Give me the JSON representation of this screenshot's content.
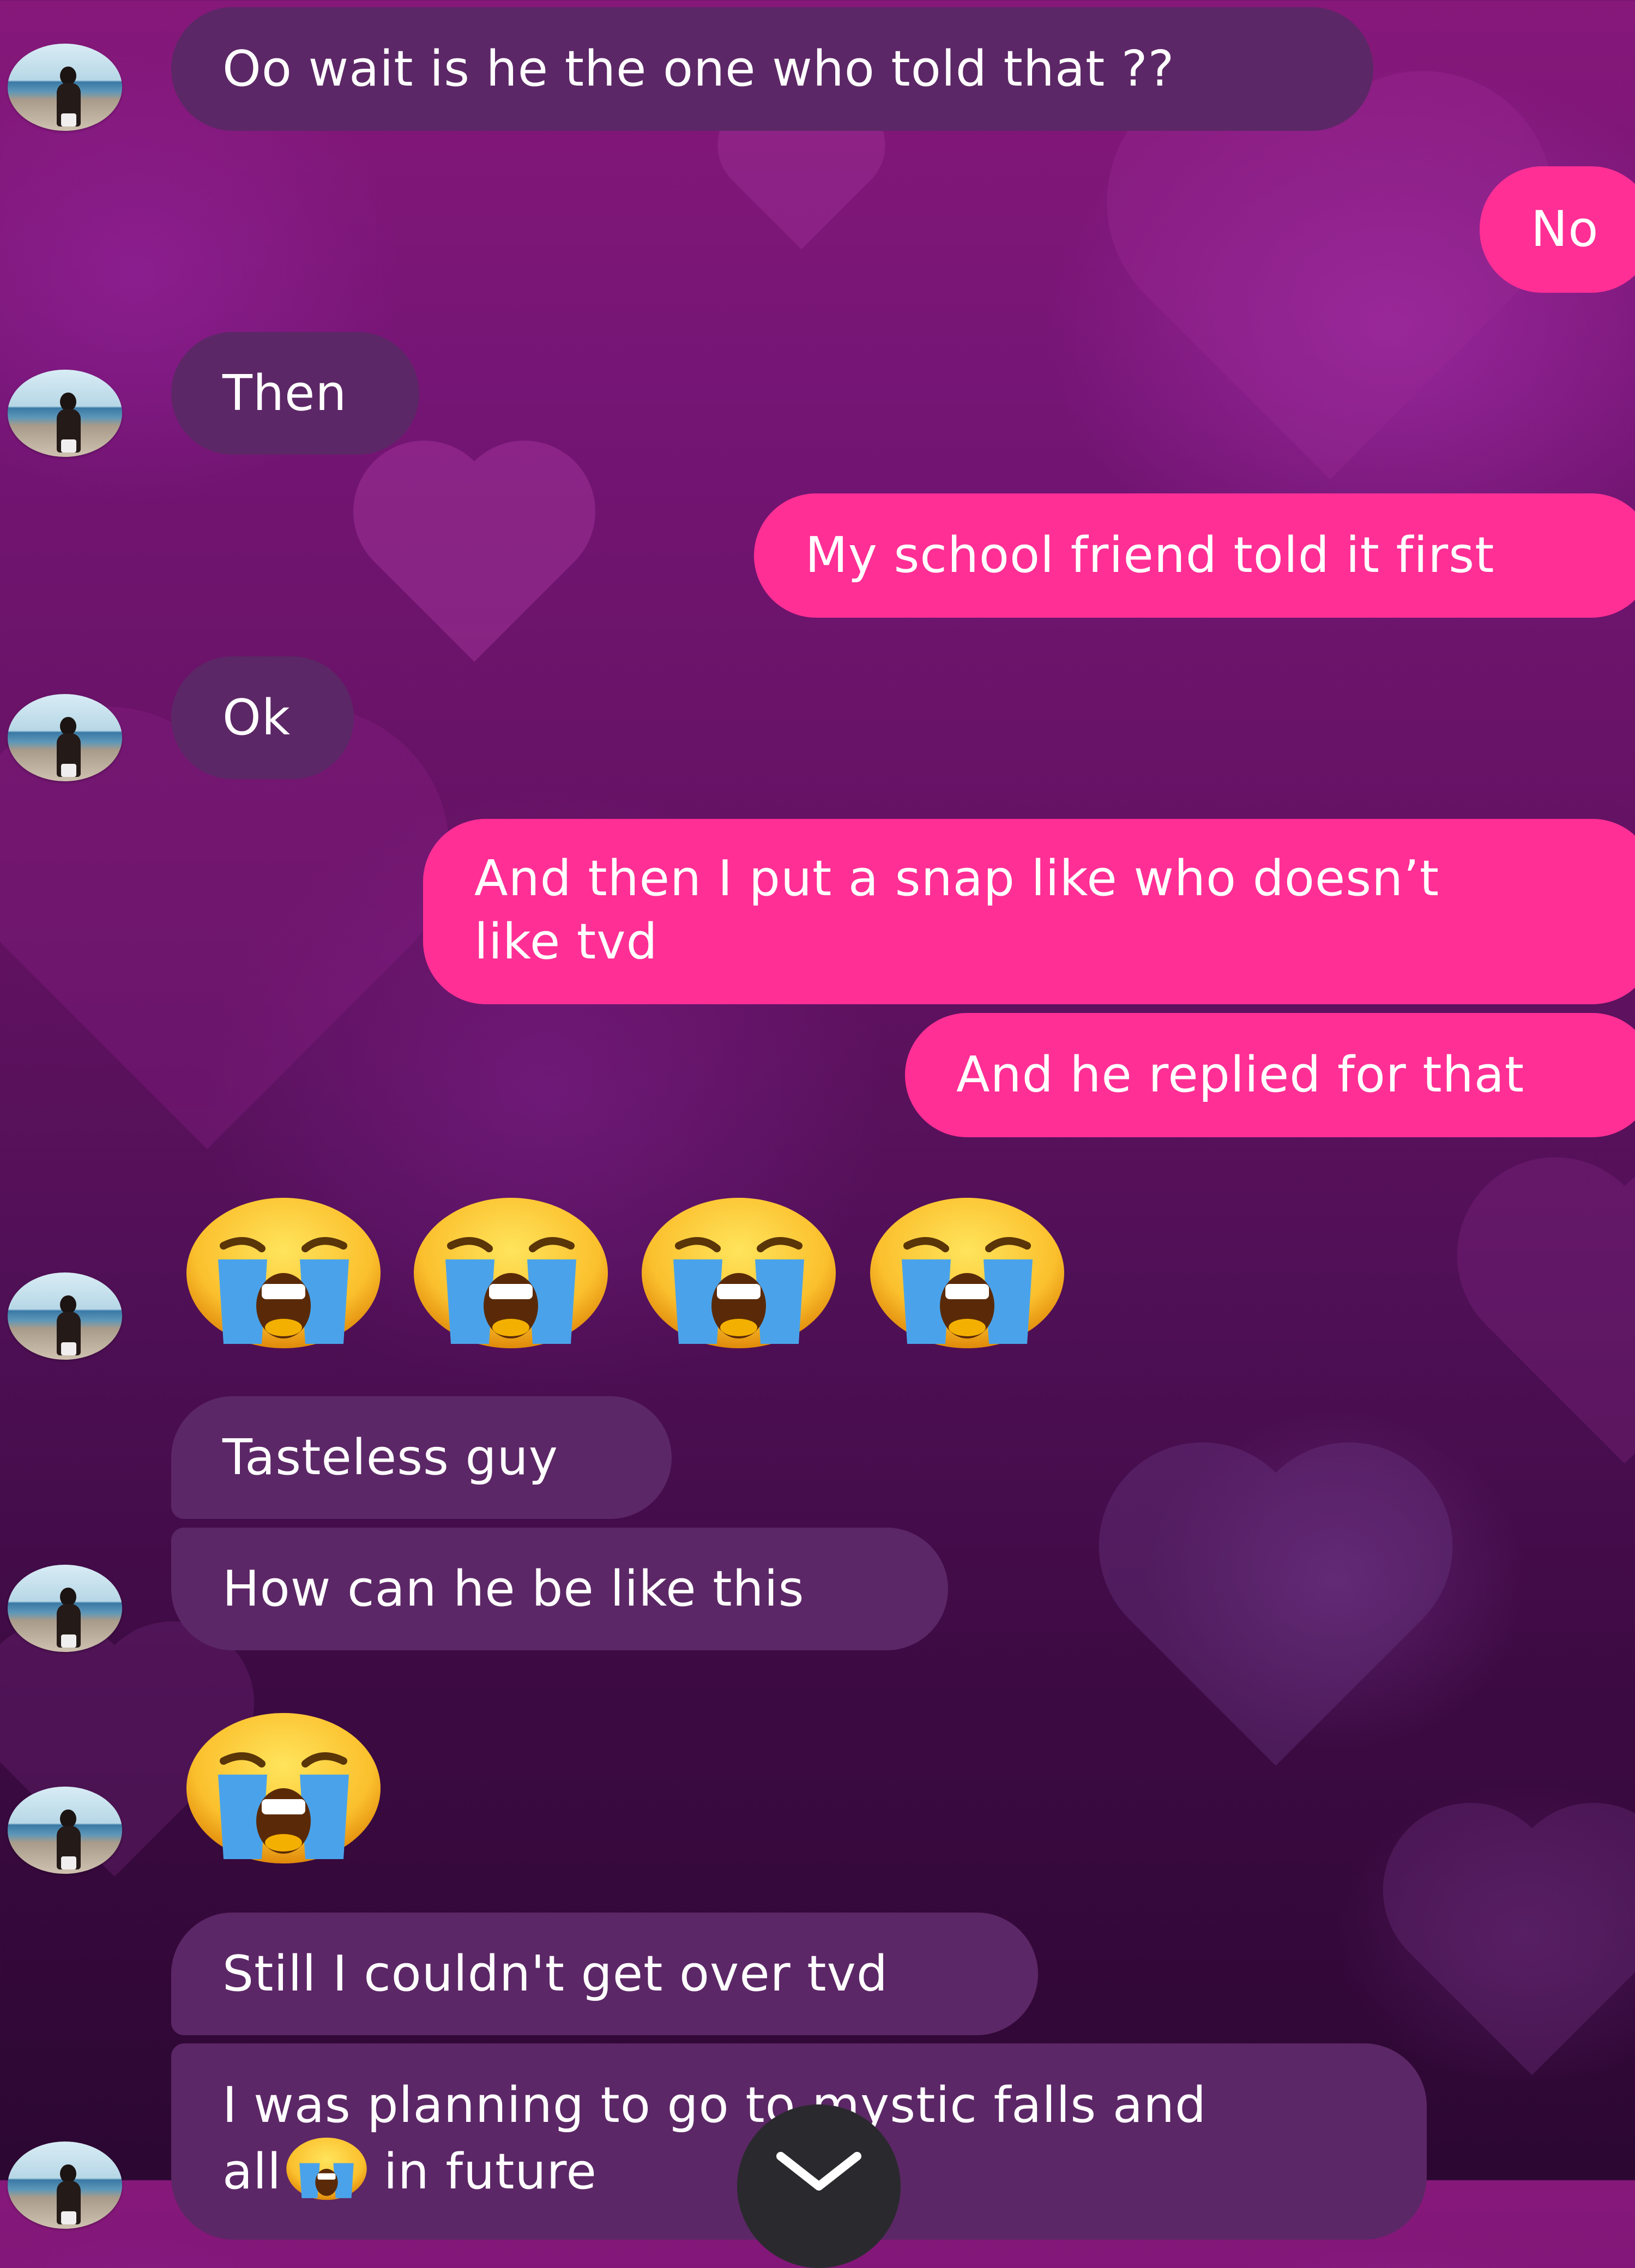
{
  "colors": {
    "incoming_bubble": "#5c2766",
    "outgoing_bubble": "#ff2f95",
    "background_top": "#86187a",
    "background_bottom": "#2c0732",
    "scroll_button": "#2a2a2e"
  },
  "messages": [
    {
      "from": "them",
      "text": "Oo wait is he the one who told that ??"
    },
    {
      "from": "me",
      "text": "No"
    },
    {
      "from": "them",
      "text": "Then"
    },
    {
      "from": "me",
      "text": "My school friend told it first"
    },
    {
      "from": "them",
      "text": "Ok"
    },
    {
      "from": "me",
      "text": "And then I put a snap like who doesn’t like tvd"
    },
    {
      "from": "me",
      "text": "And he replied for that"
    },
    {
      "from": "them",
      "emoji": [
        "loudly-crying-face",
        "loudly-crying-face",
        "loudly-crying-face",
        "loudly-crying-face"
      ]
    },
    {
      "from": "them",
      "text": "Tasteless guy"
    },
    {
      "from": "them",
      "text": "How can he be like this"
    },
    {
      "from": "them",
      "emoji": [
        "loudly-crying-face"
      ]
    },
    {
      "from": "them",
      "text": "Still I couldn't get over tvd"
    },
    {
      "from": "them",
      "text": "I was planning to go to mystic falls and all in future",
      "inline_emoji": "loudly-crying-face"
    }
  ],
  "text": {
    "m1": "Oo wait is he the one who told that ??",
    "m2": "No",
    "m3": "Then",
    "m4": "My school friend told it first",
    "m5": "Ok",
    "m6_line1": "And then I put a snap like who doesn’t",
    "m6_line2": "like tvd",
    "m7": "And he replied for that",
    "m9": "Tasteless guy",
    "m10": "How can he be like this",
    "m12": "Still I couldn't get over tvd",
    "m13_line1": "I was planning to go to mystic falls and",
    "m13_line2a": "all",
    "m13_line2b": " in future"
  },
  "icons": {
    "avatar": "beach-profile-photo",
    "emoji": "loudly-crying-face",
    "scroll_down": "chevron-down-icon"
  }
}
